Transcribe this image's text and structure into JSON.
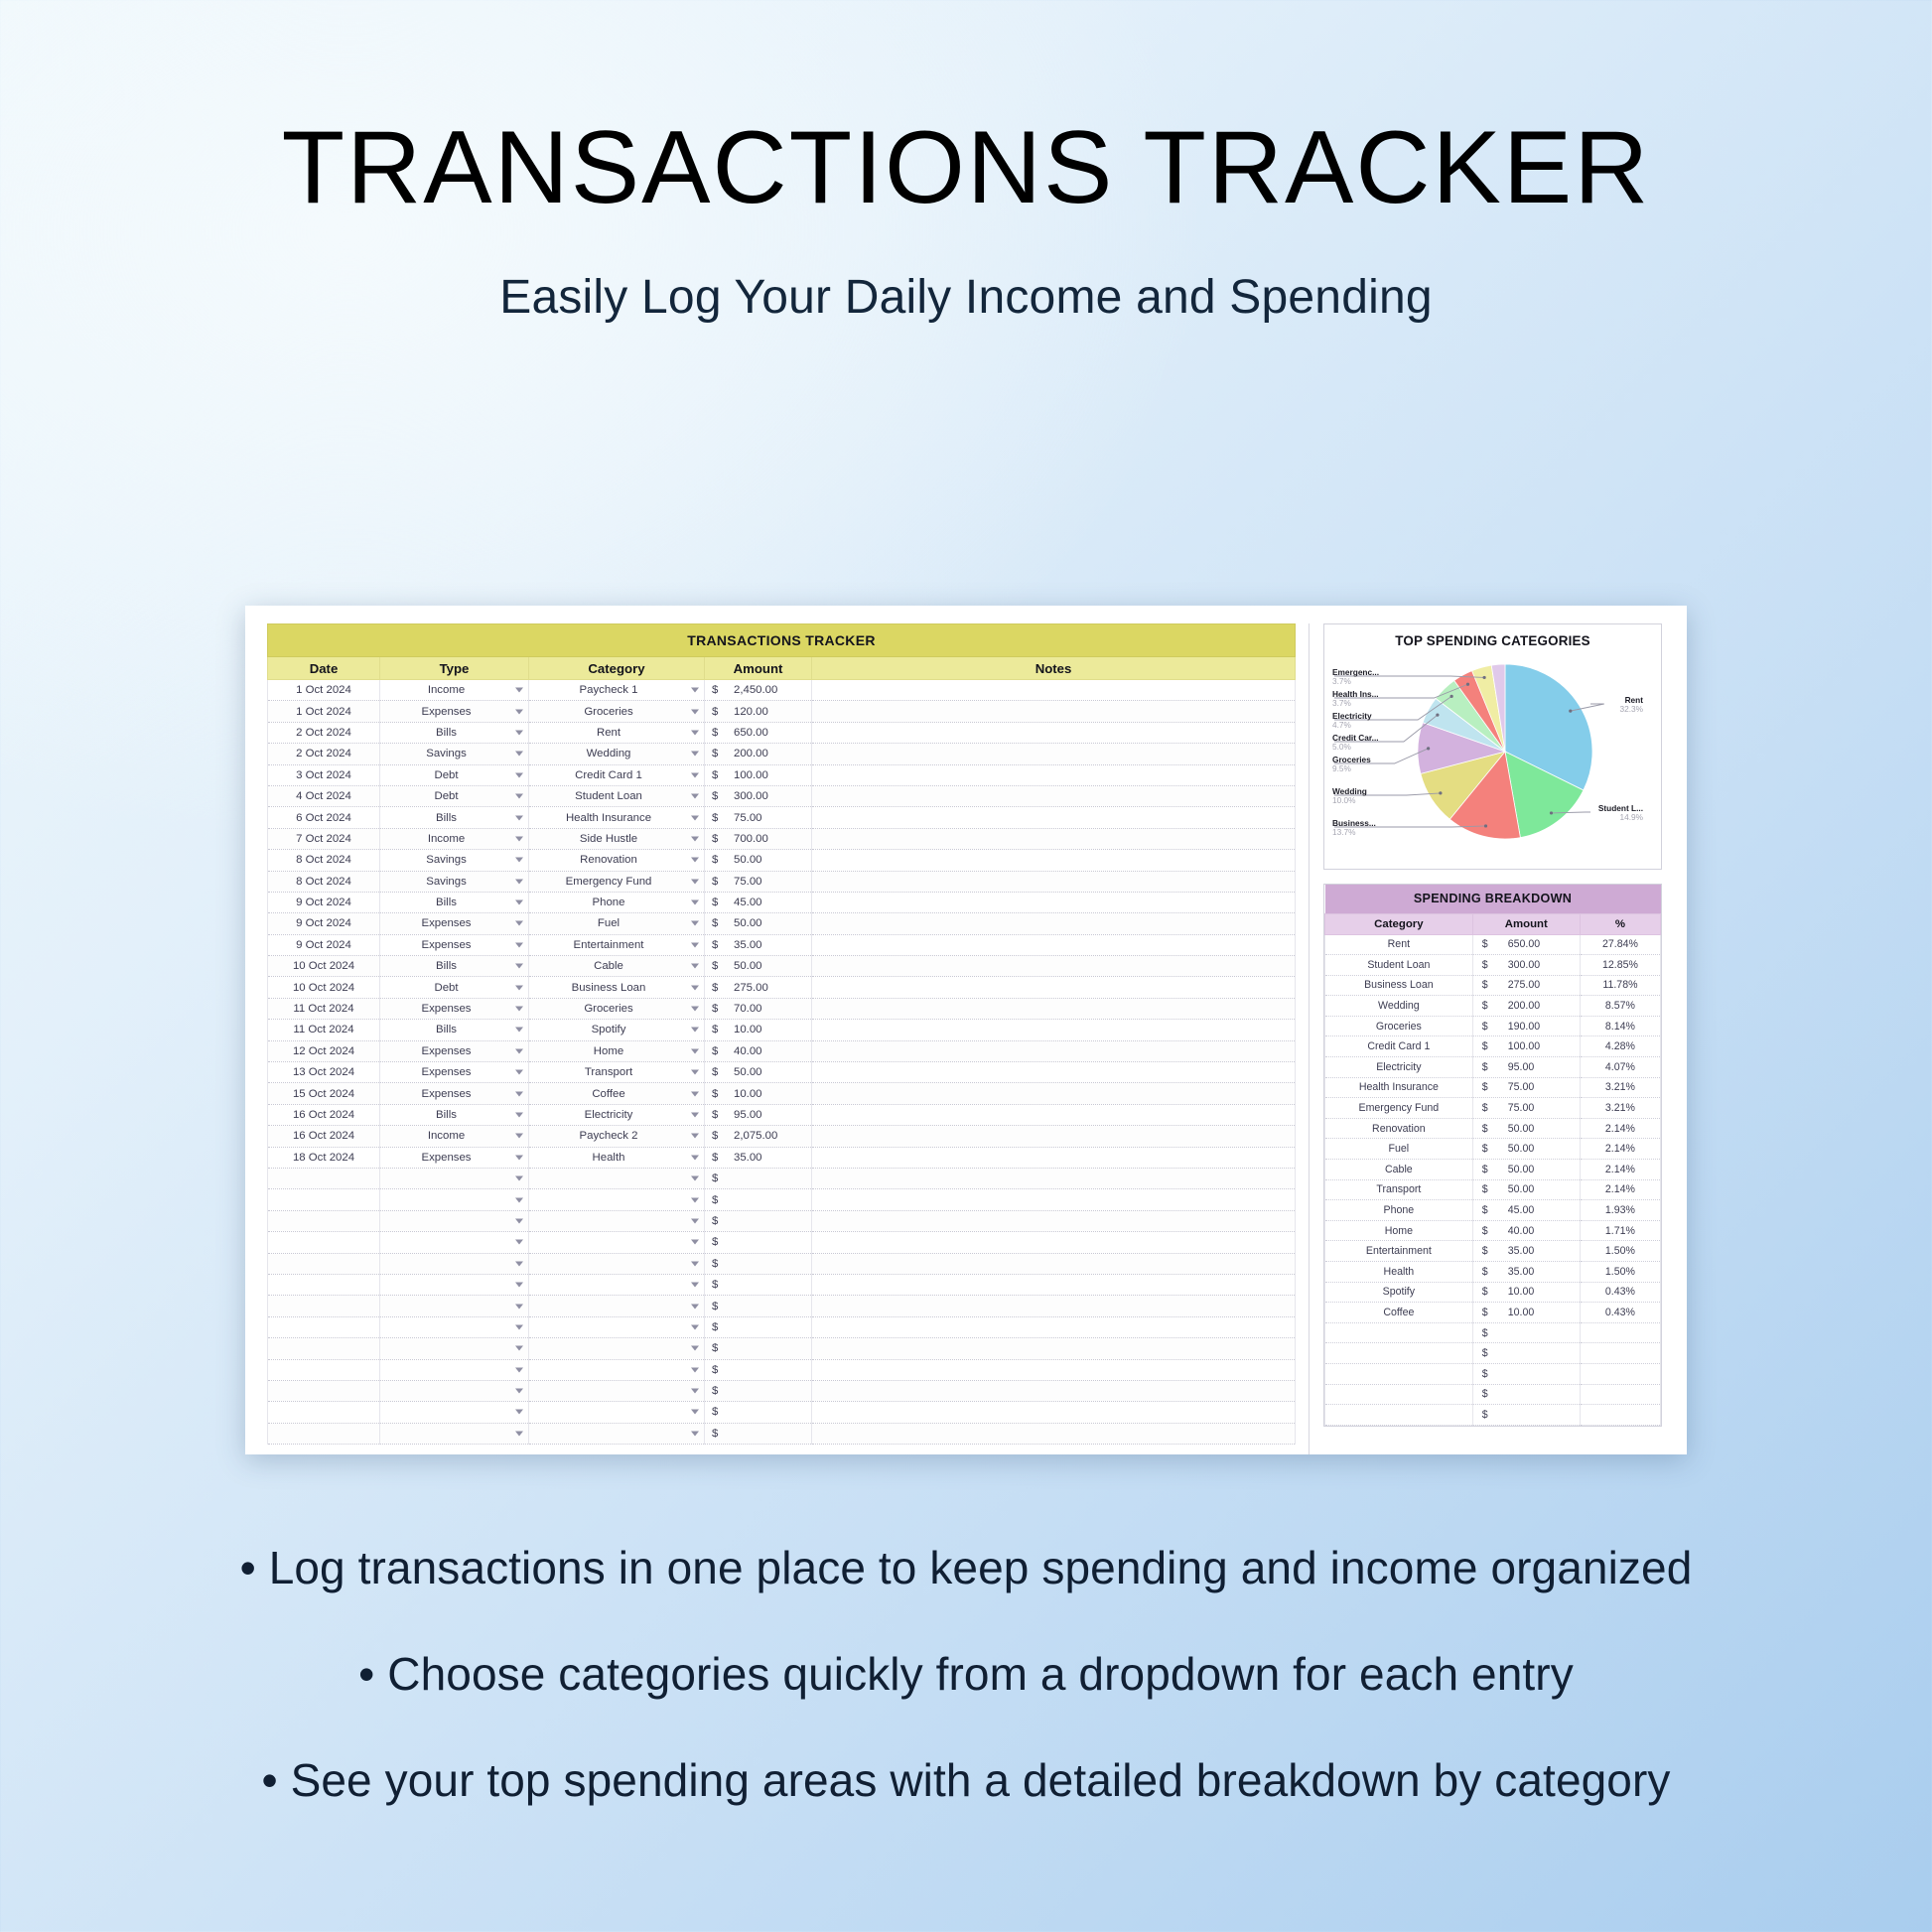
{
  "header": {
    "title": "TRANSACTIONS TRACKER",
    "subtitle": "Easily Log Your Daily Income and Spending"
  },
  "mockup": {
    "tracker": {
      "banner": "TRANSACTIONS TRACKER",
      "columns": [
        "Date",
        "Type",
        "Category",
        "Amount",
        "Notes"
      ],
      "currency_symbol": "$",
      "rows": [
        {
          "date": "1 Oct 2024",
          "type": "Income",
          "category": "Paycheck 1",
          "amount": "2,450.00",
          "notes": ""
        },
        {
          "date": "1 Oct 2024",
          "type": "Expenses",
          "category": "Groceries",
          "amount": "120.00",
          "notes": ""
        },
        {
          "date": "2 Oct 2024",
          "type": "Bills",
          "category": "Rent",
          "amount": "650.00",
          "notes": ""
        },
        {
          "date": "2 Oct 2024",
          "type": "Savings",
          "category": "Wedding",
          "amount": "200.00",
          "notes": ""
        },
        {
          "date": "3 Oct 2024",
          "type": "Debt",
          "category": "Credit Card 1",
          "amount": "100.00",
          "notes": ""
        },
        {
          "date": "4 Oct 2024",
          "type": "Debt",
          "category": "Student Loan",
          "amount": "300.00",
          "notes": ""
        },
        {
          "date": "6 Oct 2024",
          "type": "Bills",
          "category": "Health Insurance",
          "amount": "75.00",
          "notes": ""
        },
        {
          "date": "7 Oct 2024",
          "type": "Income",
          "category": "Side Hustle",
          "amount": "700.00",
          "notes": ""
        },
        {
          "date": "8 Oct 2024",
          "type": "Savings",
          "category": "Renovation",
          "amount": "50.00",
          "notes": ""
        },
        {
          "date": "8 Oct 2024",
          "type": "Savings",
          "category": "Emergency Fund",
          "amount": "75.00",
          "notes": ""
        },
        {
          "date": "9 Oct 2024",
          "type": "Bills",
          "category": "Phone",
          "amount": "45.00",
          "notes": ""
        },
        {
          "date": "9 Oct 2024",
          "type": "Expenses",
          "category": "Fuel",
          "amount": "50.00",
          "notes": ""
        },
        {
          "date": "9 Oct 2024",
          "type": "Expenses",
          "category": "Entertainment",
          "amount": "35.00",
          "notes": ""
        },
        {
          "date": "10 Oct 2024",
          "type": "Bills",
          "category": "Cable",
          "amount": "50.00",
          "notes": ""
        },
        {
          "date": "10 Oct 2024",
          "type": "Debt",
          "category": "Business Loan",
          "amount": "275.00",
          "notes": ""
        },
        {
          "date": "11 Oct 2024",
          "type": "Expenses",
          "category": "Groceries",
          "amount": "70.00",
          "notes": ""
        },
        {
          "date": "11 Oct 2024",
          "type": "Bills",
          "category": "Spotify",
          "amount": "10.00",
          "notes": ""
        },
        {
          "date": "12 Oct 2024",
          "type": "Expenses",
          "category": "Home",
          "amount": "40.00",
          "notes": ""
        },
        {
          "date": "13 Oct 2024",
          "type": "Expenses",
          "category": "Transport",
          "amount": "50.00",
          "notes": ""
        },
        {
          "date": "15 Oct 2024",
          "type": "Expenses",
          "category": "Coffee",
          "amount": "10.00",
          "notes": ""
        },
        {
          "date": "16 Oct 2024",
          "type": "Bills",
          "category": "Electricity",
          "amount": "95.00",
          "notes": ""
        },
        {
          "date": "16 Oct 2024",
          "type": "Income",
          "category": "Paycheck 2",
          "amount": "2,075.00",
          "notes": ""
        },
        {
          "date": "18 Oct 2024",
          "type": "Expenses",
          "category": "Health",
          "amount": "35.00",
          "notes": ""
        }
      ],
      "empty_row_count": 13
    },
    "breakdown": {
      "banner": "SPENDING BREAKDOWN",
      "columns": [
        "Category",
        "Amount",
        "%"
      ],
      "currency_symbol": "$",
      "rows": [
        {
          "category": "Rent",
          "amount": "650.00",
          "pct": "27.84%"
        },
        {
          "category": "Student Loan",
          "amount": "300.00",
          "pct": "12.85%"
        },
        {
          "category": "Business Loan",
          "amount": "275.00",
          "pct": "11.78%"
        },
        {
          "category": "Wedding",
          "amount": "200.00",
          "pct": "8.57%"
        },
        {
          "category": "Groceries",
          "amount": "190.00",
          "pct": "8.14%"
        },
        {
          "category": "Credit Card 1",
          "amount": "100.00",
          "pct": "4.28%"
        },
        {
          "category": "Electricity",
          "amount": "95.00",
          "pct": "4.07%"
        },
        {
          "category": "Health Insurance",
          "amount": "75.00",
          "pct": "3.21%"
        },
        {
          "category": "Emergency Fund",
          "amount": "75.00",
          "pct": "3.21%"
        },
        {
          "category": "Renovation",
          "amount": "50.00",
          "pct": "2.14%"
        },
        {
          "category": "Fuel",
          "amount": "50.00",
          "pct": "2.14%"
        },
        {
          "category": "Cable",
          "amount": "50.00",
          "pct": "2.14%"
        },
        {
          "category": "Transport",
          "amount": "50.00",
          "pct": "2.14%"
        },
        {
          "category": "Phone",
          "amount": "45.00",
          "pct": "1.93%"
        },
        {
          "category": "Home",
          "amount": "40.00",
          "pct": "1.71%"
        },
        {
          "category": "Entertainment",
          "amount": "35.00",
          "pct": "1.50%"
        },
        {
          "category": "Health",
          "amount": "35.00",
          "pct": "1.50%"
        },
        {
          "category": "Spotify",
          "amount": "10.00",
          "pct": "0.43%"
        },
        {
          "category": "Coffee",
          "amount": "10.00",
          "pct": "0.43%"
        }
      ],
      "empty_row_count": 5
    }
  },
  "chart_data": {
    "type": "pie",
    "title": "TOP SPENDING CATEGORIES",
    "legend": "callout-labels",
    "labels": [
      "Rent",
      "Student L...",
      "Business...",
      "Wedding",
      "Groceries",
      "Credit Car...",
      "Electricity",
      "Health Ins...",
      "Emergenc..."
    ],
    "values": [
      32.3,
      14.9,
      13.7,
      10.0,
      9.5,
      5.0,
      4.7,
      3.7,
      3.7
    ],
    "value_labels": [
      "32.3%",
      "14.9%",
      "13.7%",
      "10.0%",
      "9.5%",
      "5.0%",
      "4.7%",
      "3.7%",
      "3.7%"
    ],
    "colors": [
      "#84cdea",
      "#7ee89a",
      "#f4817c",
      "#e4dd82",
      "#d3b2de",
      "#bfe4ef",
      "#b8efc0",
      "#f4817c",
      "#f0eda4"
    ],
    "other_slice_color": "#e0c9ea",
    "other_slice_value": 2.5
  },
  "bullets": [
    "• Log transactions in one place to keep spending and income organized",
    "• Choose categories quickly from a dropdown for each entry",
    "• See your top spending areas with a detailed breakdown by category"
  ]
}
